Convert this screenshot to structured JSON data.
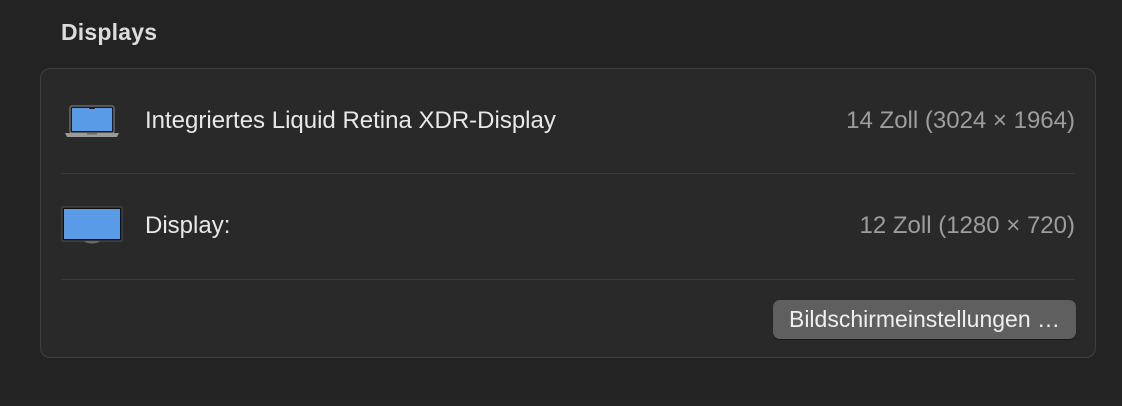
{
  "section": {
    "title": "Displays"
  },
  "displays": [
    {
      "icon": "laptop-icon",
      "name": "Integriertes Liquid Retina XDR-Display",
      "spec": "14 Zoll (3024 × 1964)"
    },
    {
      "icon": "monitor-icon",
      "name": "Display:",
      "spec": "12 Zoll (1280 × 720)"
    }
  ],
  "actions": {
    "settings_label": "Bildschirmeinstellungen …"
  },
  "colors": {
    "background": "#232323",
    "panel": "#292929",
    "screen_blue": "#5a9be8",
    "button": "#5f5f5f"
  }
}
